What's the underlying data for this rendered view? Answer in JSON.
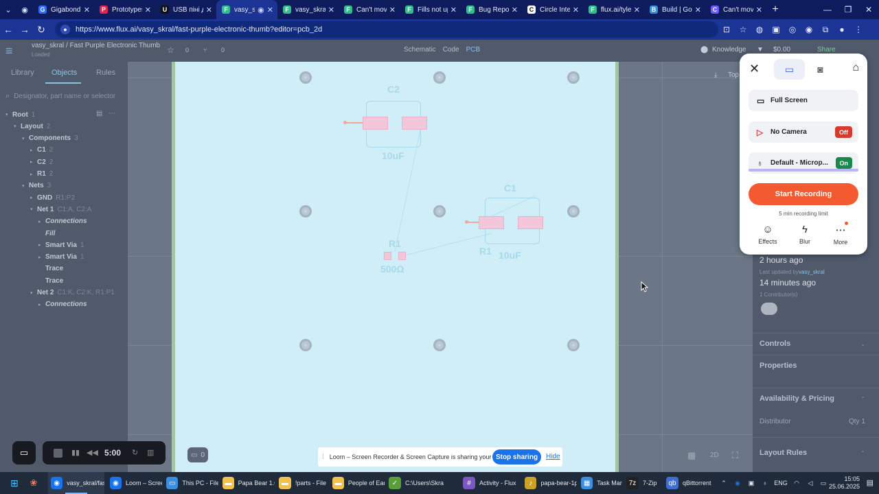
{
  "browser": {
    "tabs": [
      {
        "label": "Gigabond -",
        "fav": "G",
        "favcolor": "#2b6cff"
      },
      {
        "label": "Prototypes",
        "fav": "P",
        "favcolor": "#e0244b"
      },
      {
        "label": "USB пінi до",
        "fav": "U",
        "favcolor": "#111111"
      },
      {
        "label": "vasy_sk",
        "fav": "F",
        "favcolor": "#2fbf8f"
      },
      {
        "label": "vasy_skral (\\",
        "fav": "F",
        "favcolor": "#2fbf8f"
      },
      {
        "label": "Can't move",
        "fav": "F",
        "favcolor": "#2fbf8f"
      },
      {
        "label": "Fills not upc",
        "fav": "F",
        "favcolor": "#2fbf8f"
      },
      {
        "label": "Bug Report:",
        "fav": "F",
        "favcolor": "#2fbf8f"
      },
      {
        "label": "Circle Interc",
        "fav": "C",
        "favcolor": "#ffffff"
      },
      {
        "label": "flux.ai/tyler",
        "fav": "F",
        "favcolor": "#2fbf8f"
      },
      {
        "label": "Build | Goo",
        "fav": "B",
        "favcolor": "#3a8dde"
      },
      {
        "label": "Can't move",
        "fav": "C",
        "favcolor": "#6b5cff"
      }
    ],
    "url": "https://www.flux.ai/vasy_skral/fast-purple-electronic-thumb?editor=pcb_2d"
  },
  "app": {
    "project_title": "vasy_skral / Fast Purple Electronic Thumb",
    "project_sub": "Loaded",
    "stars": "0",
    "forks": "0",
    "modes": [
      "Schematic",
      "Code",
      "PCB"
    ],
    "knowledge": "Knowledge",
    "price": "$0.00",
    "share": "Share"
  },
  "left": {
    "tabs": [
      "Library",
      "Objects",
      "Rules"
    ],
    "search_placeholder": "Designator, part name or selector",
    "tree": [
      {
        "label": "Root",
        "meta": "1",
        "indent": 0,
        "chev": "▾",
        "italic": false
      },
      {
        "label": "Layout",
        "meta": "2",
        "indent": 1,
        "chev": "▾",
        "italic": false
      },
      {
        "label": "Components",
        "meta": "3",
        "indent": 2,
        "chev": "▾",
        "italic": false
      },
      {
        "label": "C1",
        "meta": "2",
        "indent": 3,
        "chev": "▸",
        "italic": false
      },
      {
        "label": "C2",
        "meta": "2",
        "indent": 3,
        "chev": "▸",
        "italic": false
      },
      {
        "label": "R1",
        "meta": "2",
        "indent": 3,
        "chev": "▸",
        "italic": false
      },
      {
        "label": "Nets",
        "meta": "3",
        "indent": 2,
        "chev": "▾",
        "italic": false
      },
      {
        "label": "GND",
        "meta": "R1:P2",
        "indent": 3,
        "chev": "▸",
        "italic": false
      },
      {
        "label": "Net 1",
        "meta": "C1:A, C2:A",
        "indent": 3,
        "chev": "▾",
        "italic": false
      },
      {
        "label": "Connections",
        "meta": "",
        "indent": 4,
        "chev": "▸",
        "italic": true
      },
      {
        "label": "Fill",
        "meta": "",
        "indent": 4,
        "chev": "",
        "italic": true
      },
      {
        "label": "Smart Via",
        "meta": "1",
        "indent": 4,
        "chev": "▸",
        "italic": false
      },
      {
        "label": "Smart Via",
        "meta": "1",
        "indent": 4,
        "chev": "▸",
        "italic": false
      },
      {
        "label": "Trace",
        "meta": "",
        "indent": 4,
        "chev": "",
        "italic": false
      },
      {
        "label": "Trace",
        "meta": "",
        "indent": 4,
        "chev": "",
        "italic": false
      },
      {
        "label": "Net 2",
        "meta": "C1:K, C2:K, R1:P1",
        "indent": 3,
        "chev": "▾",
        "italic": false
      },
      {
        "label": "Connections",
        "meta": "",
        "indent": 4,
        "chev": "▸",
        "italic": true
      }
    ]
  },
  "pcb": {
    "labels": {
      "c2": "C2",
      "c2_val": "10uF",
      "c1": "C1",
      "c1_val": "10uF",
      "r1": "R1",
      "r1_val": "500Ω",
      "r1_side": "R1"
    }
  },
  "right": {
    "top_btn": "Top",
    "ago1": "2 hours ago",
    "updated_by_prefix": "Last updated by",
    "updated_by_user": "vasy_skral",
    "ago2": "14 minutes ago",
    "contributors": "1 Contributor(s)",
    "sections": [
      "Controls",
      "Properties",
      "Availability & Pricing"
    ],
    "distributor": "Distributor",
    "qty": "Qty 1",
    "layout_rules": "Layout Rules"
  },
  "loom": {
    "full_screen": "Full Screen",
    "no_camera": "No Camera",
    "no_camera_state": "Off",
    "mic": "Default - Microp...",
    "mic_state": "On",
    "start": "Start Recording",
    "limit": "5 min recording limit",
    "tools": [
      "Effects",
      "Blur",
      "More"
    ]
  },
  "recorder": {
    "time": "5:00",
    "comments": "0"
  },
  "share_bar": {
    "message": "Loom – Screen Recorder & Screen Capture is sharing your screen.",
    "stop": "Stop sharing",
    "hide": "Hide"
  },
  "view": {
    "mode_2d": "2D"
  },
  "taskbar": {
    "items": [
      {
        "label": "vasy_skral/fas",
        "color": "#1a73e8",
        "icon": "◉"
      },
      {
        "label": "Loom – Scree",
        "color": "#1a73e8",
        "icon": "◉"
      },
      {
        "label": "This PC - File",
        "color": "#3c8ee0",
        "icon": "▭"
      },
      {
        "label": "Papa Bear 1.0",
        "color": "#f2c14e",
        "icon": "▬"
      },
      {
        "label": "!parts - File",
        "color": "#f2c14e",
        "icon": "▬"
      },
      {
        "label": "People of Earl",
        "color": "#f2c14e",
        "icon": "▬"
      },
      {
        "label": "C:\\Users\\Skra",
        "color": "#5a9e3a",
        "icon": "✓"
      },
      {
        "label": "Activity - Flux",
        "color": "#7b57c4",
        "icon": "#"
      },
      {
        "label": "papa-bear-1p",
        "color": "#c9a227",
        "icon": "♪"
      },
      {
        "label": "Task Man",
        "color": "#3c8ee0",
        "icon": "▦"
      },
      {
        "label": "7-Zip",
        "color": "#222222",
        "icon": "7z"
      },
      {
        "label": "qBittorrent",
        "color": "#3c6fd1",
        "icon": "qb"
      }
    ],
    "lang": "ENG",
    "time": "15:05",
    "date": "25.06.2025"
  }
}
